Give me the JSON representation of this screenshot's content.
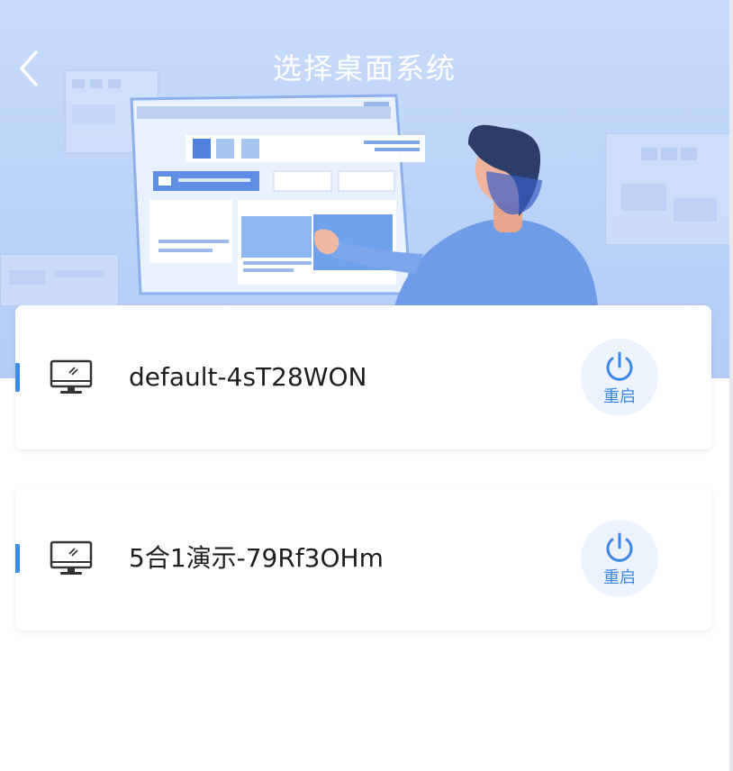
{
  "header": {
    "title": "选择桌面系统",
    "back_icon": "chevron-left-icon"
  },
  "desktops": [
    {
      "name": "default-4sT28WON",
      "icon": "monitor-icon",
      "action_label": "重启",
      "action_icon": "power-icon"
    },
    {
      "name": "5合1演示-79Rf3OHm",
      "icon": "monitor-icon",
      "action_label": "重启",
      "action_icon": "power-icon"
    }
  ],
  "colors": {
    "accent": "#3f8bea",
    "hero_background": "#c9dcfb",
    "title_text": "#ffffff",
    "restart_bg": "#edf3fd"
  }
}
